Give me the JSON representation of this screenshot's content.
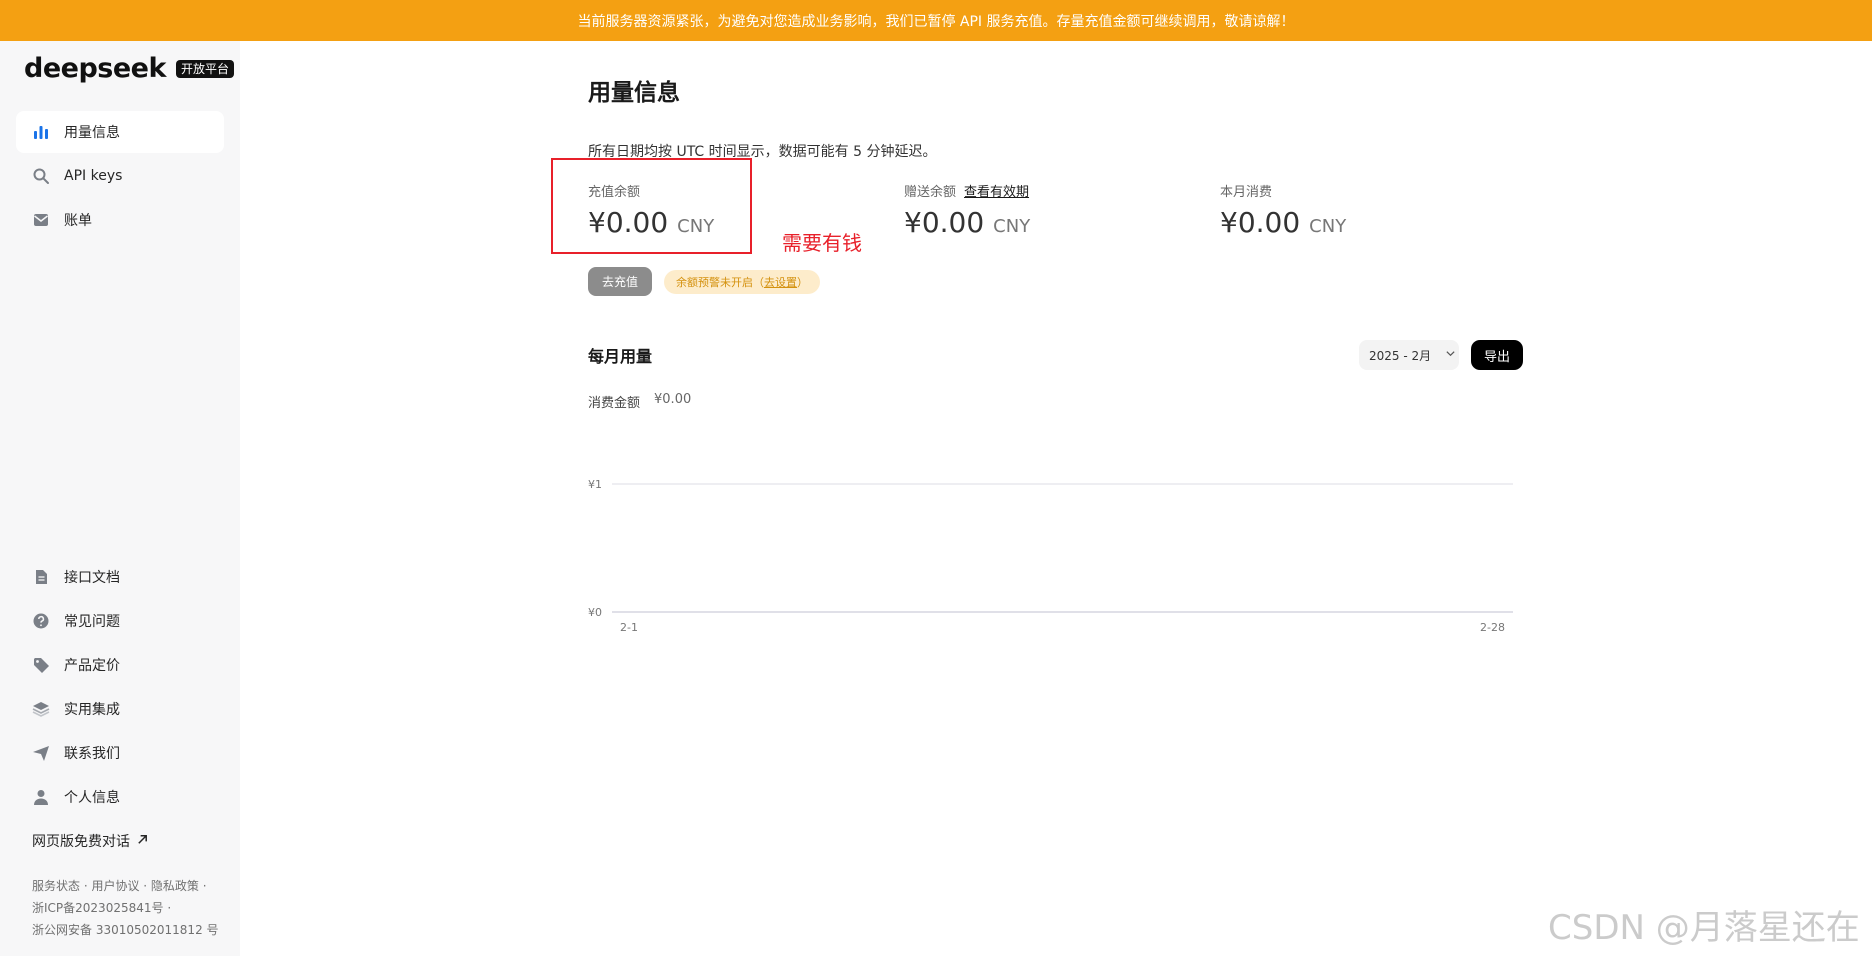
{
  "banner": {
    "text": "当前服务器资源紧张，为避免对您造成业务影响，我们已暂停 API 服务充值。存量充值金额可继续调用，敬请谅解！"
  },
  "logo": {
    "text": "deepseek",
    "badge": "开放平台"
  },
  "sidebar": {
    "top_items": [
      {
        "label": "用量信息",
        "icon": "bar-chart-icon",
        "active": true
      },
      {
        "label": "API keys",
        "icon": "search-icon",
        "active": false
      },
      {
        "label": "账单",
        "icon": "envelope-icon",
        "active": false
      }
    ],
    "bottom_items": [
      {
        "label": "接口文档",
        "icon": "document-icon"
      },
      {
        "label": "常见问题",
        "icon": "question-icon"
      },
      {
        "label": "产品定价",
        "icon": "tag-icon"
      },
      {
        "label": "实用集成",
        "icon": "layers-icon"
      },
      {
        "label": "联系我们",
        "icon": "send-icon"
      },
      {
        "label": "个人信息",
        "icon": "user-icon"
      }
    ],
    "web_chat": "网页版免费对话",
    "footer": [
      "服务状态 · 用户协议 · 隐私政策 ·",
      "浙ICP备2023025841号 ·",
      "浙公网安备 33010502011812 号"
    ]
  },
  "main": {
    "title": "用量信息",
    "tz_note": "所有日期均按 UTC 时间显示，数据可能有 5 分钟延迟。",
    "stats": [
      {
        "label": "充值余额",
        "amount": "¥0.00",
        "unit": "CNY"
      },
      {
        "label": "赠送余额",
        "link": "查看有效期",
        "amount": "¥0.00",
        "unit": "CNY"
      },
      {
        "label": "本月消费",
        "amount": "¥0.00",
        "unit": "CNY"
      }
    ],
    "annotation": "需要有钱",
    "recharge_button": "去充值",
    "alert": {
      "text": "余额预警未开启（",
      "link": "去设置",
      "suffix": "）"
    },
    "monthly": {
      "title": "每月用量",
      "month_select": "2025 - 2月",
      "export_button": "导出",
      "spend_label": "消费金额",
      "spend_value": "¥0.00"
    }
  },
  "chart_data": {
    "type": "line",
    "x": [
      "2-1",
      "2-28"
    ],
    "y_ticks": [
      "¥1",
      "¥0"
    ],
    "ylim": [
      0,
      1
    ],
    "series": [
      {
        "values": [
          0,
          0
        ]
      }
    ]
  },
  "watermark": "CSDN @月落星还在",
  "colors": {
    "banner": "#f4a012",
    "annotation": "#e8202a",
    "alert_bg": "#fdeccb",
    "alert_text": "#d4910e",
    "accent": "#1a73e8"
  }
}
